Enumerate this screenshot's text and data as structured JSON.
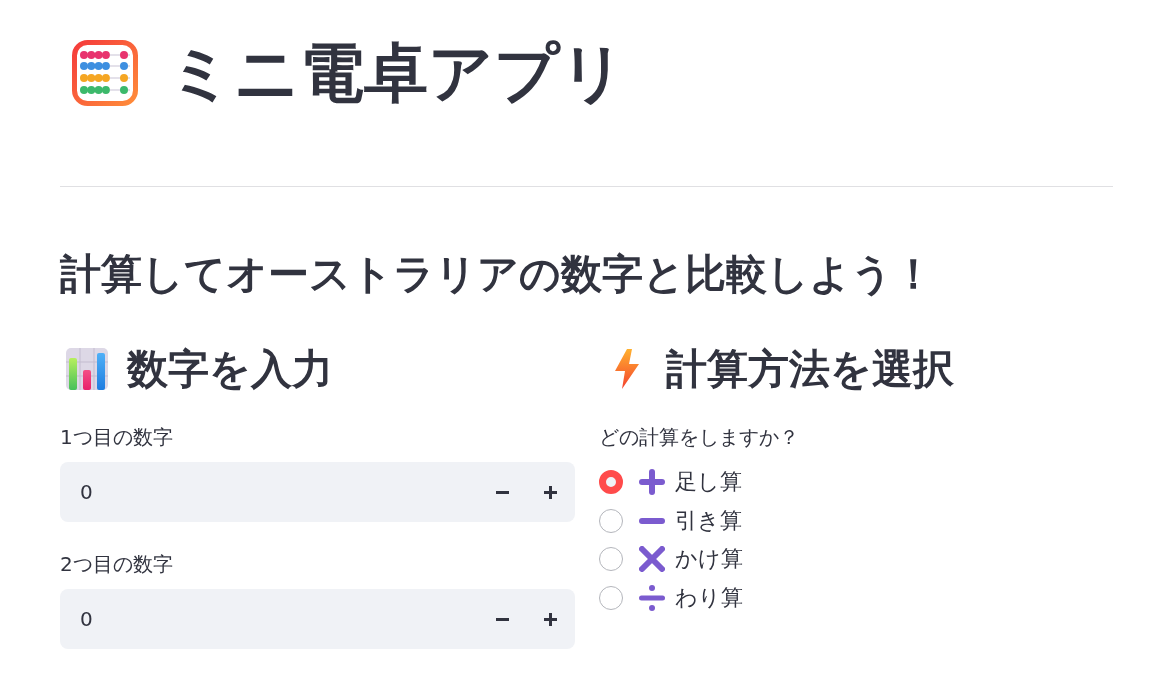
{
  "header": {
    "title": "ミニ電卓アプリ"
  },
  "subtitle": "計算してオーストラリアの数字と比較しよう！",
  "input_section": {
    "heading": "数字を入力",
    "fields": [
      {
        "label": "1つ目の数字",
        "value": "0"
      },
      {
        "label": "2つ目の数字",
        "value": "0"
      }
    ]
  },
  "operation_section": {
    "heading": "計算方法を選択",
    "question": "どの計算をしますか？",
    "options": [
      {
        "kind": "plus",
        "label": "足し算",
        "selected": true
      },
      {
        "kind": "minus",
        "label": "引き算",
        "selected": false
      },
      {
        "kind": "multiply",
        "label": "かけ算",
        "selected": false
      },
      {
        "kind": "divide",
        "label": "わり算",
        "selected": false
      }
    ]
  }
}
